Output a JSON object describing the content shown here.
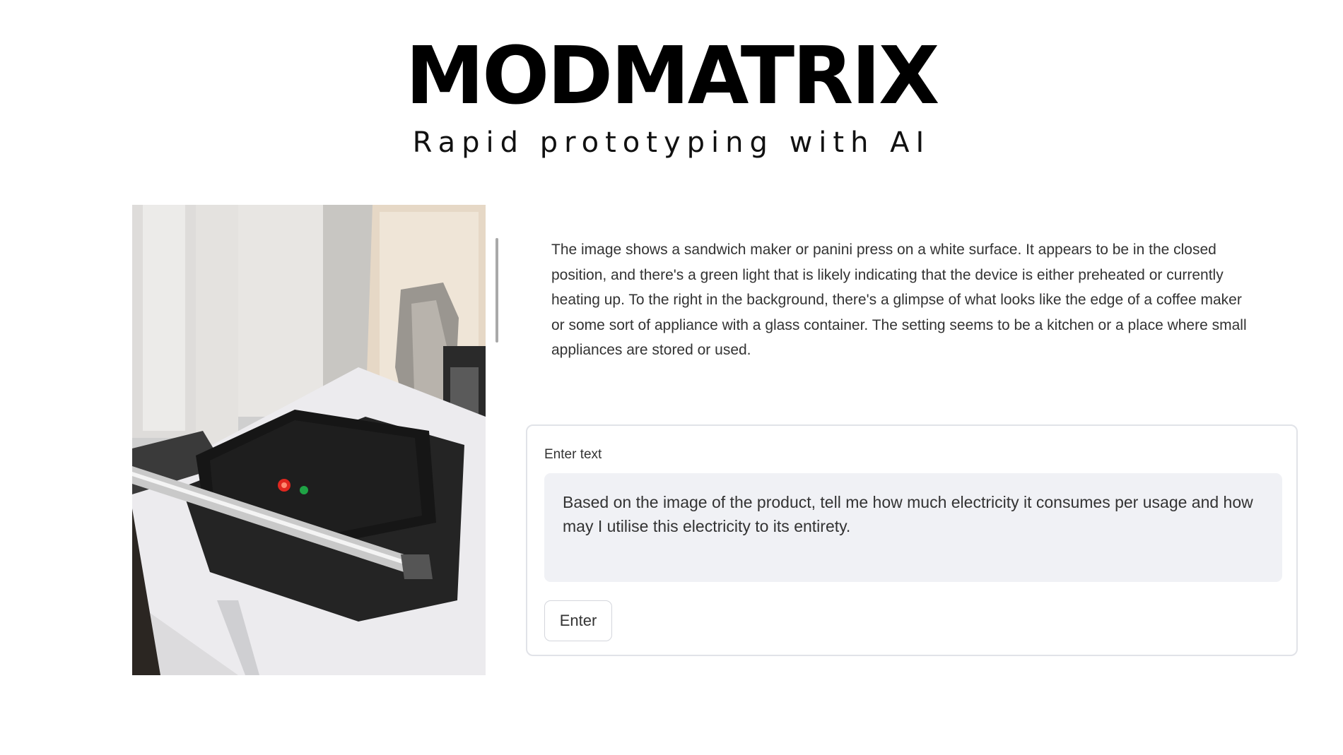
{
  "header": {
    "brand": "MODMATRIX",
    "tagline": "Rapid prototyping with AI"
  },
  "image_panel": {
    "subject": "sandwich maker / panini press on a white surface"
  },
  "response": {
    "text": "The image shows a sandwich maker or panini press on a white surface. It appears to be in the closed position, and there's a green light that is likely indicating that the device is either preheated or currently heating up. To the right in the background, there's a glimpse of what looks like the edge of a coffee maker or some sort of appliance with a glass container. The setting seems to be a kitchen or a place where small appliances are stored or used."
  },
  "form": {
    "label": "Enter text",
    "value": "Based on the image of the product, tell me how much electricity it consumes per usage and how may I utilise this electricity to its entirety.",
    "submit_label": "Enter"
  }
}
